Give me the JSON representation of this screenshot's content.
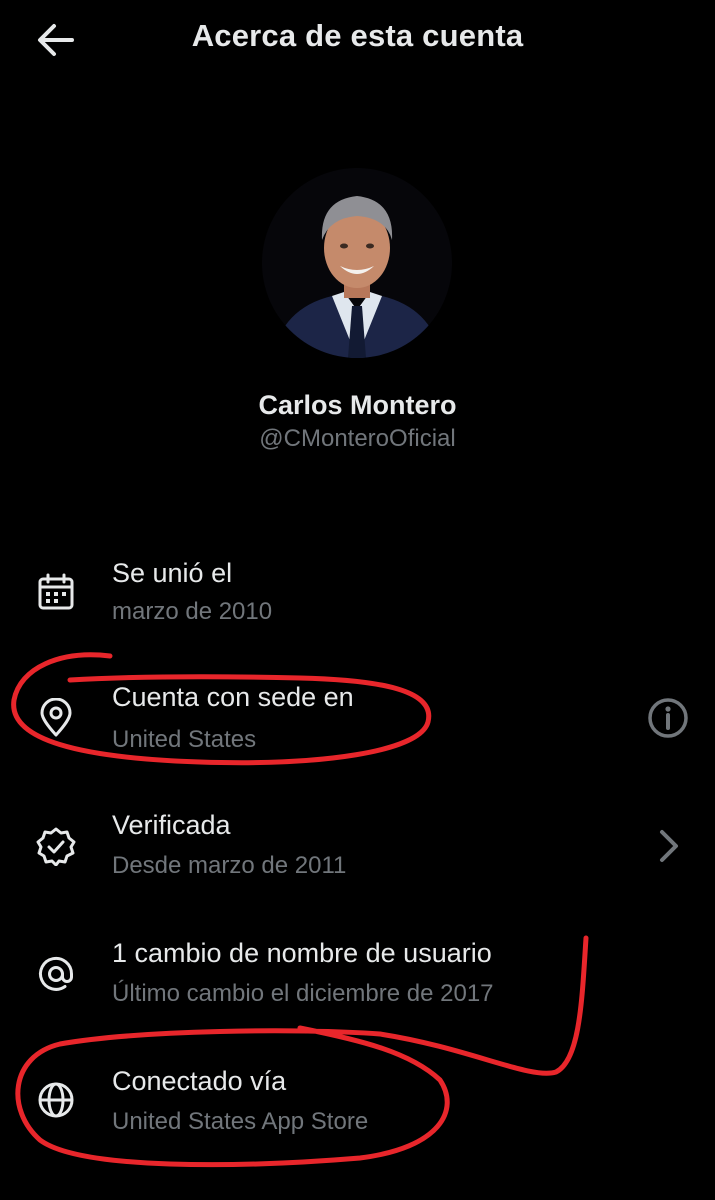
{
  "header": {
    "title": "Acerca de esta cuenta",
    "back_icon": "arrow-left-icon"
  },
  "profile": {
    "name": "Carlos Montero",
    "handle": "@CMonteroOficial"
  },
  "rows": [
    {
      "icon": "calendar-icon",
      "label": "Se unió el",
      "sub": "marzo de 2010"
    },
    {
      "icon": "location-pin-icon",
      "label": "Cuenta con sede en",
      "sub": "United States",
      "trailing": "info-icon"
    },
    {
      "icon": "verified-badge-icon",
      "label": "Verificada",
      "sub": "Desde marzo de 2011",
      "trailing": "chevron-right-icon"
    },
    {
      "icon": "at-sign-icon",
      "label": "1 cambio de nombre de usuario",
      "sub": "Último cambio el diciembre de 2017"
    },
    {
      "icon": "globe-icon",
      "label": "Conectado vía",
      "sub": "United States App Store"
    }
  ],
  "colors": {
    "background": "#000000",
    "primary_text": "#e7e9ea",
    "secondary_text": "#71767b",
    "annotation": "#e8262b"
  }
}
